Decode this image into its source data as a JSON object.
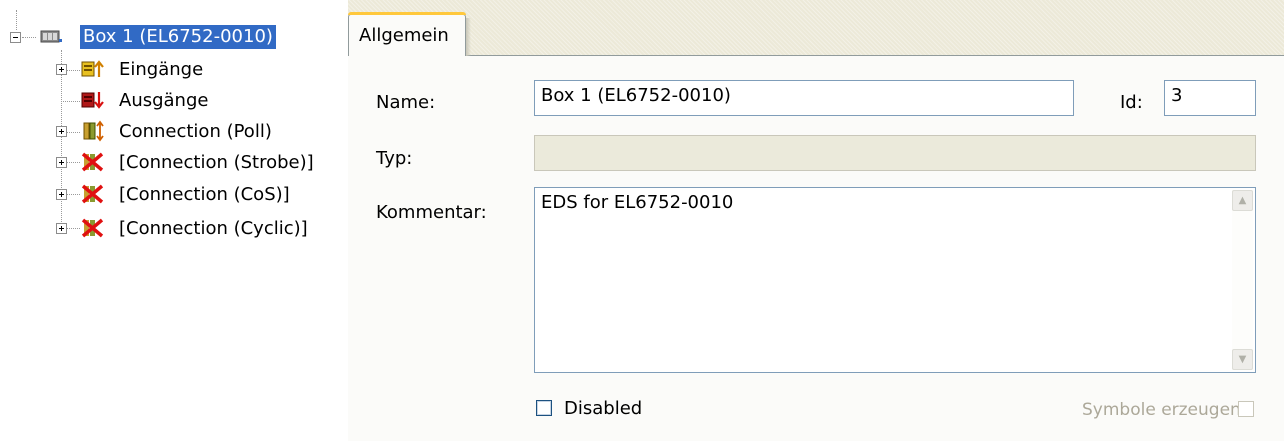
{
  "tree": {
    "root": {
      "label": "Box 1 (EL6752-0010)",
      "selected": true
    },
    "children": [
      {
        "label": "Eingänge",
        "icon": "inputs-icon"
      },
      {
        "label": "Ausgänge",
        "icon": "outputs-icon"
      },
      {
        "label": "Connection (Poll)",
        "icon": "connection-poll-icon"
      },
      {
        "label": "[Connection (Strobe)]",
        "icon": "connection-disabled-icon"
      },
      {
        "label": "[Connection (CoS)]",
        "icon": "connection-disabled-icon"
      },
      {
        "label": "[Connection (Cyclic)]",
        "icon": "connection-disabled-icon"
      }
    ]
  },
  "tabs": [
    {
      "label": "Allgemein",
      "active": true
    }
  ],
  "form": {
    "name_label": "Name:",
    "name_value": "Box 1 (EL6752-0010)",
    "id_label": "Id:",
    "id_value": "3",
    "type_label": "Typ:",
    "type_value": "",
    "comment_label": "Kommentar:",
    "comment_value": "EDS for EL6752-0010",
    "disabled_label": "Disabled",
    "disabled_checked": false,
    "symbols_label": "Symbole erzeugen",
    "symbols_checked": false
  },
  "colors": {
    "selection": "#316ac5",
    "panel": "#ece9d8",
    "tab_accent": "#ffc83c"
  }
}
